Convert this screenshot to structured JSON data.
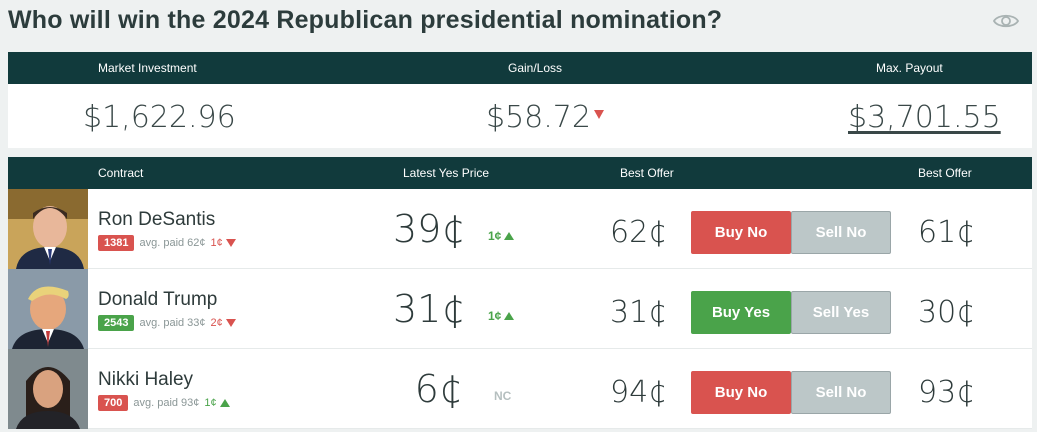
{
  "page": {
    "title": "Who will win the 2024 Republican presidential nomination?",
    "eye_icon": "eye-icon"
  },
  "summary": {
    "headers": {
      "investment": "Market Investment",
      "gainloss": "Gain/Loss",
      "payout": "Max. Payout"
    },
    "investment": "$1,622.96",
    "gainloss": "$58.72",
    "gainloss_direction": "down",
    "payout": "$3,701.55"
  },
  "table": {
    "headers": {
      "contract": "Contract",
      "latest": "Latest Yes Price",
      "best_offer_1": "Best Offer",
      "best_offer_2": "Best Offer"
    },
    "rows": [
      {
        "name": "Ron DeSantis",
        "shares": "1381",
        "shares_color": "red",
        "avg_paid": "avg. paid 62¢",
        "avg_change": "1¢",
        "avg_change_direction": "down",
        "latest_price": "39¢",
        "price_change": "1¢",
        "price_change_direction": "up",
        "best_offer_1": "62¢",
        "buy_label": "Buy No",
        "buy_color": "red",
        "sell_label": "Sell No",
        "best_offer_2": "61¢"
      },
      {
        "name": "Donald Trump",
        "shares": "2543",
        "shares_color": "green",
        "avg_paid": "avg. paid 33¢",
        "avg_change": "2¢",
        "avg_change_direction": "down",
        "latest_price": "31¢",
        "price_change": "1¢",
        "price_change_direction": "up",
        "best_offer_1": "31¢",
        "buy_label": "Buy Yes",
        "buy_color": "green",
        "sell_label": "Sell Yes",
        "best_offer_2": "30¢"
      },
      {
        "name": "Nikki Haley",
        "shares": "700",
        "shares_color": "red",
        "avg_paid": "avg. paid 93¢",
        "avg_change": "1¢",
        "avg_change_direction": "up",
        "latest_price": "6¢",
        "price_change": "NC",
        "price_change_direction": "none",
        "best_offer_1": "94¢",
        "buy_label": "Buy No",
        "buy_color": "red",
        "sell_label": "Sell No",
        "best_offer_2": "93¢"
      }
    ]
  },
  "colors": {
    "header_bg": "#113a3c",
    "red": "#d9534f",
    "green": "#4aa34a",
    "sell_gray": "#bcc7c8"
  }
}
